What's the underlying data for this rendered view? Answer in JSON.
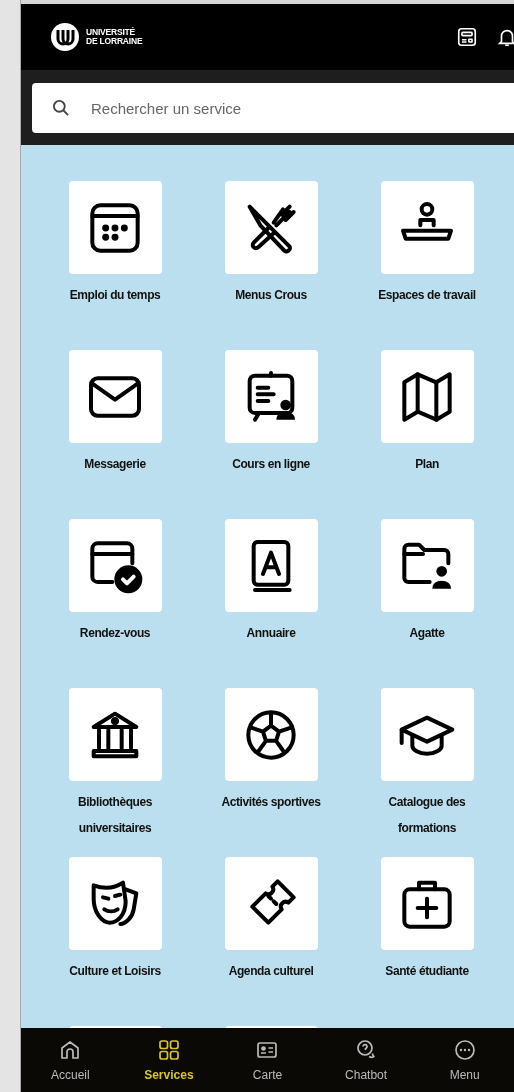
{
  "header": {
    "logo_line_1": "UNIVERSITÉ",
    "logo_line_2": "DE LORRAINE"
  },
  "search": {
    "placeholder": "Rechercher un service"
  },
  "services": [
    {
      "label": "Emploi du temps"
    },
    {
      "label": "Menus Crous"
    },
    {
      "label": "Espaces de travail"
    },
    {
      "label": "Messagerie"
    },
    {
      "label": "Cours en ligne"
    },
    {
      "label": "Plan"
    },
    {
      "label": "Rendez-vous"
    },
    {
      "label": "Annuaire"
    },
    {
      "label": "Agatte"
    },
    {
      "label": "Bibliothèques universitaires"
    },
    {
      "label": "Activités sportives"
    },
    {
      "label": "Catalogue des formations"
    },
    {
      "label": "Culture et Loisirs"
    },
    {
      "label": "Agenda culturel"
    },
    {
      "label": "Santé étudiante"
    }
  ],
  "bottom_nav": [
    {
      "label": "Accueil",
      "selected": false
    },
    {
      "label": "Services",
      "selected": true
    },
    {
      "label": "Carte",
      "selected": false
    },
    {
      "label": "Chatbot",
      "selected": false
    },
    {
      "label": "Menu",
      "selected": false
    }
  ]
}
